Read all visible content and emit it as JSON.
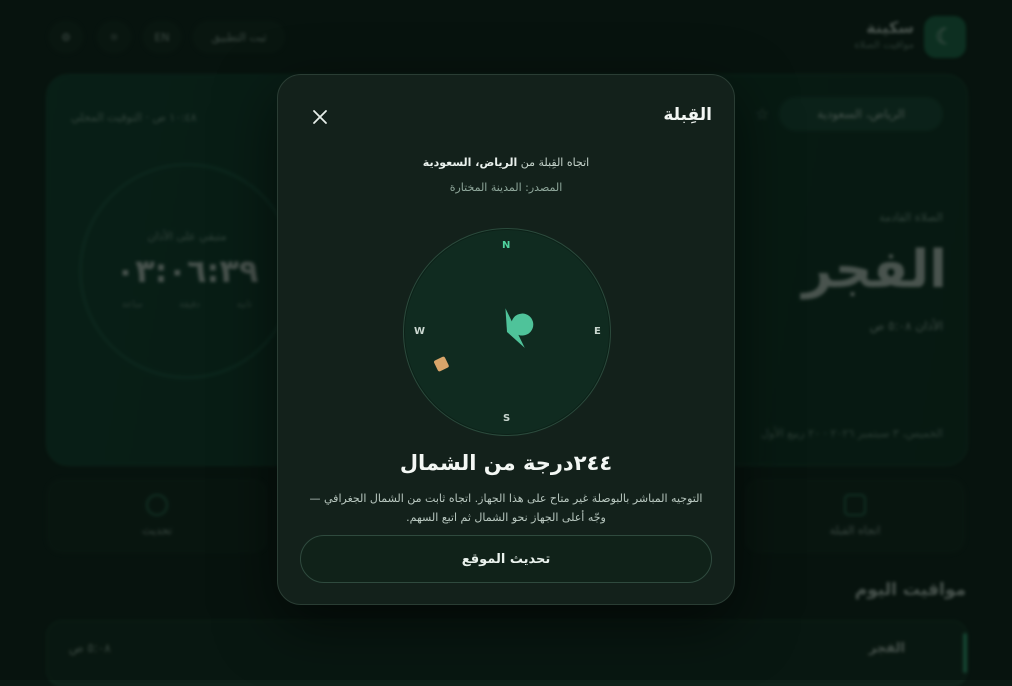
{
  "app": {
    "name": "سكينة",
    "subtitle": "مواقيت الصلاة",
    "header_buttons": {
      "install": "ثبت التطبيق",
      "lang": "EN"
    }
  },
  "hero": {
    "location": "الرياض، السعودية",
    "next_label": "الصلاة القادمة",
    "prayer": "الفجر",
    "prayer_time": "الأذان ٥:٠٨ ص",
    "date": "الخميس، ٣ سبتمبر ٢٠٢٦",
    "hijri": "٢٠ ربيع الأول",
    "corner_text": "١٠:٤٨ ص · التوقيت المحلي",
    "countdown_label": "متبقي على الأذان",
    "countdown": "٠٣:٠٦:٣٩",
    "units": [
      "ساعة",
      "دقيقة",
      "ثانية"
    ]
  },
  "quick": {
    "left": "تحديث",
    "right": "اتجاه القبلة"
  },
  "today": {
    "title": "مواقيت اليوم",
    "first_row": {
      "name": "الفجر",
      "time": "٥:٠٨ ص"
    }
  },
  "qibla": {
    "title": "القِبلة",
    "from_prefix": "اتجاه القِبلة من",
    "from_city": "الرياض، السعودية",
    "source": "المصدر: المدينة المختارة",
    "cardinals": {
      "n": "N",
      "e": "E",
      "s": "S",
      "w": "W"
    },
    "bearing_deg": 244,
    "bearing_text": "٢٤٤درجة من الشمال",
    "note": "التوجيه المباشر بالبوصلة غير متاح على هذا الجهاز. اتجاه ثابت من الشمال الجغرافي — وجّه أعلى الجهاز نحو الشمال ثم اتبع السهم.",
    "refresh_label": "تحديث الموقع",
    "colors": {
      "arrow": "#4fc39a",
      "kaaba": "#d9a56a",
      "north": "#4fd39e"
    }
  }
}
